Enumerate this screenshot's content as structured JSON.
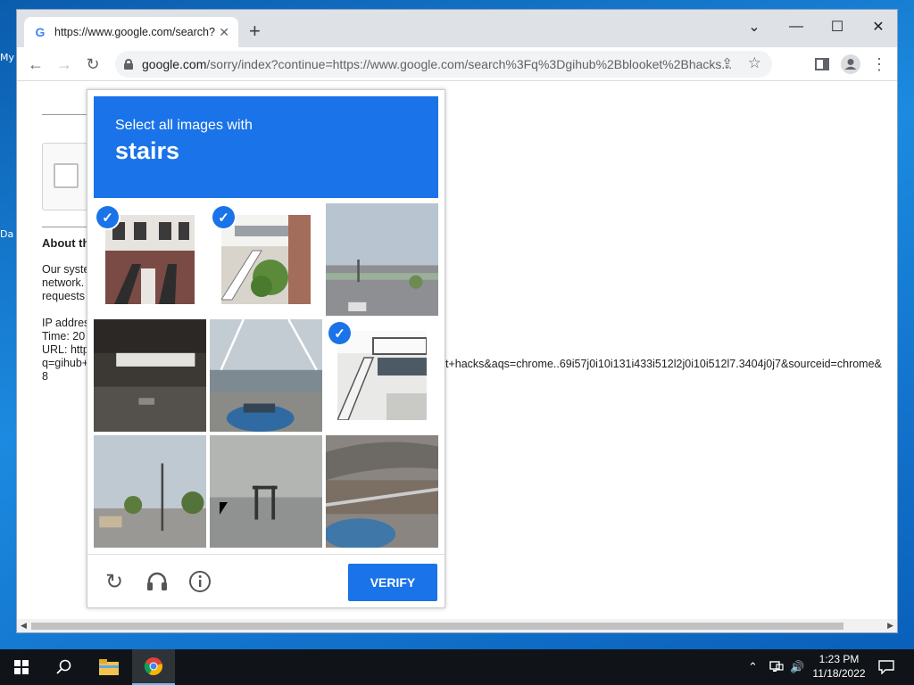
{
  "desktop": {
    "icon_labels": [
      "My",
      "Da"
    ]
  },
  "browser": {
    "tab": {
      "favicon": "G",
      "title": "https://www.google.com/search?"
    },
    "address_bar": {
      "host": "google.com",
      "path": "/sorry/index?continue=https://www.google.com/search%3Fq%3Dgihub%2Bblooket%2Bhacks..."
    }
  },
  "page": {
    "about_heading": "About th",
    "paragraph_lines": [
      "Our syste",
      "network.",
      "requests"
    ],
    "info_lines": [
      "IP addres",
      "Time: 20",
      "URL: http",
      "q=gihub+",
      "8"
    ],
    "url_tail": "t+hacks&aqs=chrome..69i57j0i10i131i433i512l2j0i10i512l7.3404j0j7&sourceid=chrome&"
  },
  "captcha": {
    "instruction_small": "Select all images with",
    "instruction_target": "stairs",
    "tiles": [
      {
        "scene": "brownstone stairs",
        "selected": true
      },
      {
        "scene": "white stair house",
        "selected": true
      },
      {
        "scene": "street view road",
        "selected": false
      },
      {
        "scene": "dark interior",
        "selected": false
      },
      {
        "scene": "bridge car",
        "selected": false
      },
      {
        "scene": "white stairs porch",
        "selected": true
      },
      {
        "scene": "palm street",
        "selected": false
      },
      {
        "scene": "gray water pier",
        "selected": false
      },
      {
        "scene": "highway car",
        "selected": false
      }
    ],
    "verify_label": "VERIFY",
    "accent_color": "#1a73e8"
  },
  "taskbar": {
    "time": "1:23 PM",
    "date": "11/18/2022"
  }
}
